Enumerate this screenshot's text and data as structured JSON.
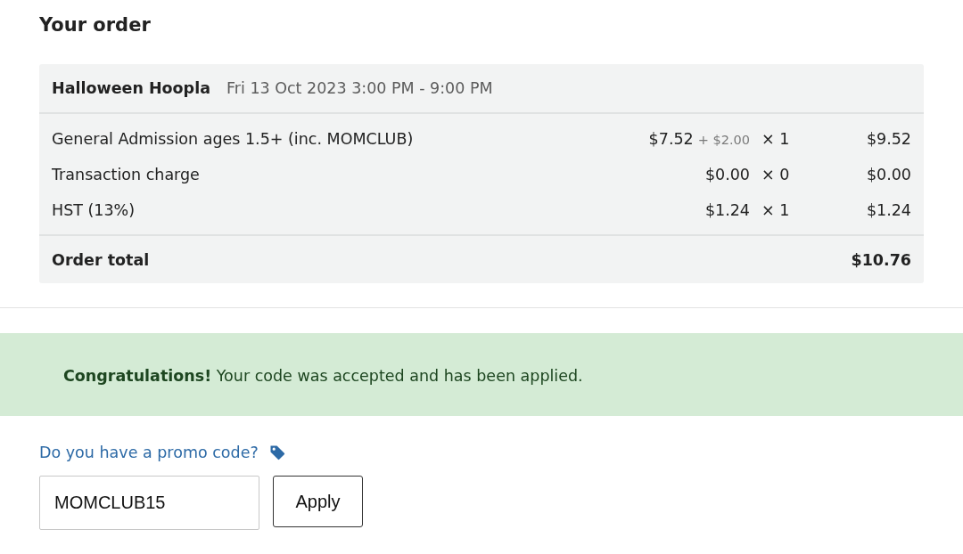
{
  "page": {
    "title": "Your order"
  },
  "order": {
    "event": {
      "name": "Halloween Hoopla",
      "date": "Fri 13 Oct 2023 3:00 PM - 9:00 PM"
    },
    "lines": [
      {
        "name": "General Admission ages 1.5+ (inc. MOMCLUB)",
        "price": "$7.52",
        "fee": "+ $2.00",
        "quantity": "× 1",
        "total": "$9.52"
      },
      {
        "name": "Transaction charge",
        "price": "$0.00",
        "quantity": "× 0",
        "total": "$0.00"
      },
      {
        "name": "HST (13%)",
        "price": "$1.24",
        "quantity": "× 1",
        "total": "$1.24"
      }
    ],
    "total": {
      "label": "Order total",
      "amount": "$10.76"
    }
  },
  "alert": {
    "kind": "success",
    "message": "**Congratulations!** Your code was accepted and has been applied."
  },
  "promo": {
    "link": "Do you have a promo code?",
    "input": {
      "value": "MOMCLUB15"
    },
    "button": "Apply"
  }
}
